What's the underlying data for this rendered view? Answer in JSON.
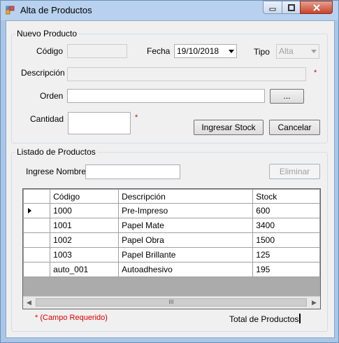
{
  "window": {
    "title": "Alta de Productos",
    "controls": [
      "minimize-icon",
      "maximize-icon",
      "close-icon"
    ]
  },
  "nuevo_producto": {
    "legend": "Nuevo Producto",
    "codigo_label": "Código",
    "codigo_value": "",
    "fecha_label": "Fecha",
    "fecha_value": "19/10/2018",
    "tipo_label": "Tipo",
    "tipo_value": "Alta",
    "descripcion_label": "Descripción",
    "descripcion_value": "",
    "orden_label": "Orden",
    "orden_value": "",
    "browse_label": "...",
    "cantidad_label": "Cantidad",
    "cantidad_value": "",
    "required_mark": "*",
    "ingresar_label": "Ingresar Stock",
    "cancelar_label": "Cancelar"
  },
  "listado": {
    "legend": "Listado de Productos",
    "nombre_label": "Ingrese Nombre",
    "nombre_value": "",
    "eliminar_label": "Eliminar",
    "columns": [
      "Código",
      "Descripción",
      "Stock"
    ],
    "rows": [
      {
        "codigo": "1000",
        "descripcion": "Pre-Impreso",
        "stock": "600",
        "selected": true
      },
      {
        "codigo": "1001",
        "descripcion": "Papel Mate",
        "stock": "3400",
        "selected": false
      },
      {
        "codigo": "1002",
        "descripcion": "Papel Obra",
        "stock": "1500",
        "selected": false
      },
      {
        "codigo": "1003",
        "descripcion": "Papel Brillante",
        "stock": "125",
        "selected": false
      },
      {
        "codigo": "auto_001",
        "descripcion": "Autoadhesivo",
        "stock": "195",
        "selected": false
      }
    ],
    "scroll_thumb_grip": "III"
  },
  "footer": {
    "required_note": "* (Campo Requerido)",
    "total_label": "Total de Productos",
    "total_value": ""
  },
  "colors": {
    "required": "#e00000",
    "title_bar": "#b8d1ee",
    "close_button": "#c7432a"
  }
}
